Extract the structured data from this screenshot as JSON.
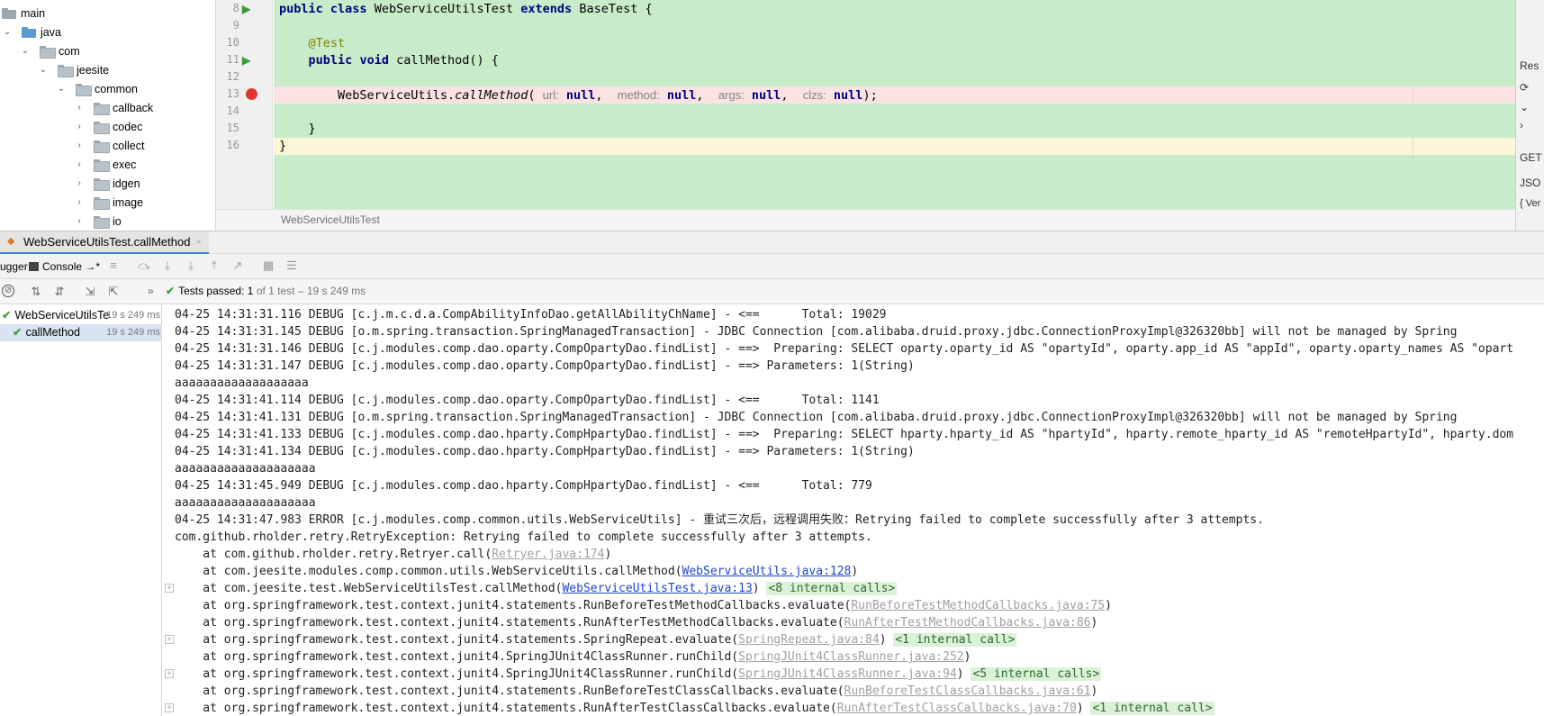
{
  "project_tree": {
    "items": [
      {
        "label": "main",
        "expanded": null
      },
      {
        "label": "java",
        "expanded": true
      },
      {
        "label": "com",
        "expanded": true
      },
      {
        "label": "jeesite",
        "expanded": true
      },
      {
        "label": "common",
        "expanded": true
      },
      {
        "label": "callback",
        "expanded": false
      },
      {
        "label": "codec",
        "expanded": false
      },
      {
        "label": "collect",
        "expanded": false
      },
      {
        "label": "exec",
        "expanded": false
      },
      {
        "label": "idgen",
        "expanded": false
      },
      {
        "label": "image",
        "expanded": false
      },
      {
        "label": "io",
        "expanded": false
      }
    ]
  },
  "editor": {
    "line_numbers": [
      "8",
      "9",
      "10",
      "11",
      "12",
      "13",
      "14",
      "15",
      "16"
    ],
    "tokens": {
      "public": "public",
      "class": "class",
      "class_name": "WebServiceUtilsTest",
      "extends": "extends",
      "base_class": "BaseTest",
      "open_brace": "{",
      "annotation": "@Test",
      "void": "void",
      "method_sig": "callMethod() {",
      "call_target": "WebServiceUtils.",
      "call_method": "callMethod",
      "paren_open": "(",
      "hint_url": "url:",
      "hint_method": "method:",
      "hint_args": "args:",
      "hint_clzs": "clzs:",
      "null": "null",
      "comma": ",",
      "end_stmt": ");",
      "close_brace": "}"
    },
    "breadcrumb": "WebServiceUtilsTest"
  },
  "right_panel": {
    "items": [
      "Res",
      "GET",
      "JSO",
      "{ Ver"
    ]
  },
  "run_tab": {
    "label": "WebServiceUtilsTest.callMethod",
    "close": "×"
  },
  "toolbar": {
    "debugger_label": "ugger",
    "console_label": "Console",
    "console_suffix": "→*"
  },
  "status": {
    "more": "»",
    "passed_label": "Tests passed:",
    "passed_count": "1",
    "passed_detail": "of 1 test – 19 s 249 ms"
  },
  "test_tree": {
    "items": [
      {
        "label": "WebServiceUtilsTe",
        "time": "19 s 249 ms"
      },
      {
        "label": "callMethod",
        "time": "19 s 249 ms"
      }
    ]
  },
  "console": {
    "lines": [
      {
        "text": "04-25 14:31:31.116 DEBUG [c.j.m.c.d.a.CompAbilityInfoDao.getAllAbilityChName] - <==      Total: 19029"
      },
      {
        "text": "04-25 14:31:31.145 DEBUG [o.m.spring.transaction.SpringManagedTransaction] - JDBC Connection [com.alibaba.druid.proxy.jdbc.ConnectionProxyImpl@326320bb] will not be managed by Spring"
      },
      {
        "text": "04-25 14:31:31.146 DEBUG [c.j.modules.comp.dao.oparty.CompOpartyDao.findList] - ==>  Preparing: SELECT oparty.oparty_id AS \"opartyId\", oparty.app_id AS \"appId\", oparty.oparty_names AS \"opart"
      },
      {
        "text": "04-25 14:31:31.147 DEBUG [c.j.modules.comp.dao.oparty.CompOpartyDao.findList] - ==> Parameters: 1(String)"
      },
      {
        "text": "aaaaaaaaaaaaaaaaaaa"
      },
      {
        "text": "04-25 14:31:41.114 DEBUG [c.j.modules.comp.dao.oparty.CompOpartyDao.findList] - <==      Total: 1141"
      },
      {
        "text": "04-25 14:31:41.131 DEBUG [o.m.spring.transaction.SpringManagedTransaction] - JDBC Connection [com.alibaba.druid.proxy.jdbc.ConnectionProxyImpl@326320bb] will not be managed by Spring"
      },
      {
        "text": "04-25 14:31:41.133 DEBUG [c.j.modules.comp.dao.hparty.CompHpartyDao.findList] - ==>  Preparing: SELECT hparty.hparty_id AS \"hpartyId\", hparty.remote_hparty_id AS \"remoteHpartyId\", hparty.dom"
      },
      {
        "text": "04-25 14:31:41.134 DEBUG [c.j.modules.comp.dao.hparty.CompHpartyDao.findList] - ==> Parameters: 1(String)"
      },
      {
        "text": "aaaaaaaaaaaaaaaaaaaa"
      },
      {
        "text": "04-25 14:31:45.949 DEBUG [c.j.modules.comp.dao.hparty.CompHpartyDao.findList] - <==      Total: 779"
      },
      {
        "text": "aaaaaaaaaaaaaaaaaaaa"
      },
      {
        "text": "04-25 14:31:47.983 ERROR [c.j.modules.comp.common.utils.WebServiceUtils] - 重试三次后，远程调用失败：Retrying failed to complete successfully after 3 attempts."
      },
      {
        "text": "com.github.rholder.retry.RetryException: Retrying failed to complete successfully after 3 attempts."
      }
    ],
    "stack": [
      {
        "prefix": "    at com.github.rholder.retry.Retryer.call(",
        "link": "Retryer.java:174",
        "link_style": "gray",
        "suffix": ")",
        "internal": "",
        "fold": false
      },
      {
        "prefix": "    at com.jeesite.modules.comp.common.utils.WebServiceUtils.callMethod(",
        "link": "WebServiceUtils.java:128",
        "link_style": "blue",
        "suffix": ")",
        "internal": "",
        "fold": false
      },
      {
        "prefix": "    at com.jeesite.test.WebServiceUtilsTest.callMethod(",
        "link": "WebServiceUtilsTest.java:13",
        "link_style": "blue",
        "suffix": ")",
        "internal": "<8 internal calls>",
        "fold": true
      },
      {
        "prefix": "    at org.springframework.test.context.junit4.statements.RunBeforeTestMethodCallbacks.evaluate(",
        "link": "RunBeforeTestMethodCallbacks.java:75",
        "link_style": "gray",
        "suffix": ")",
        "internal": "",
        "fold": false
      },
      {
        "prefix": "    at org.springframework.test.context.junit4.statements.RunAfterTestMethodCallbacks.evaluate(",
        "link": "RunAfterTestMethodCallbacks.java:86",
        "link_style": "gray",
        "suffix": ")",
        "internal": "",
        "fold": false
      },
      {
        "prefix": "    at org.springframework.test.context.junit4.statements.SpringRepeat.evaluate(",
        "link": "SpringRepeat.java:84",
        "link_style": "gray",
        "suffix": ")",
        "internal": "<1 internal call>",
        "fold": true
      },
      {
        "prefix": "    at org.springframework.test.context.junit4.SpringJUnit4ClassRunner.runChild(",
        "link": "SpringJUnit4ClassRunner.java:252",
        "link_style": "gray",
        "suffix": ")",
        "internal": "",
        "fold": false
      },
      {
        "prefix": "    at org.springframework.test.context.junit4.SpringJUnit4ClassRunner.runChild(",
        "link": "SpringJUnit4ClassRunner.java:94",
        "link_style": "gray",
        "suffix": ")",
        "internal": "<5 internal calls>",
        "fold": true
      },
      {
        "prefix": "    at org.springframework.test.context.junit4.statements.RunBeforeTestClassCallbacks.evaluate(",
        "link": "RunBeforeTestClassCallbacks.java:61",
        "link_style": "gray",
        "suffix": ")",
        "internal": "",
        "fold": false
      },
      {
        "prefix": "    at org.springframework.test.context.junit4.statements.RunAfterTestClassCallbacks.evaluate(",
        "link": "RunAfterTestClassCallbacks.java:70",
        "link_style": "gray",
        "suffix": ")",
        "internal": "<1 internal call>",
        "fold": true
      }
    ]
  },
  "colors": {
    "editor_bg": "#c8ecca",
    "breakpoint_line": "#fbe3e3",
    "current_line": "#fbf6d8",
    "breakpoint": "#e0362d",
    "keyword": "#000080",
    "annotation": "#808000",
    "link": "#2047c8",
    "pass_green": "#4a9e4a"
  }
}
